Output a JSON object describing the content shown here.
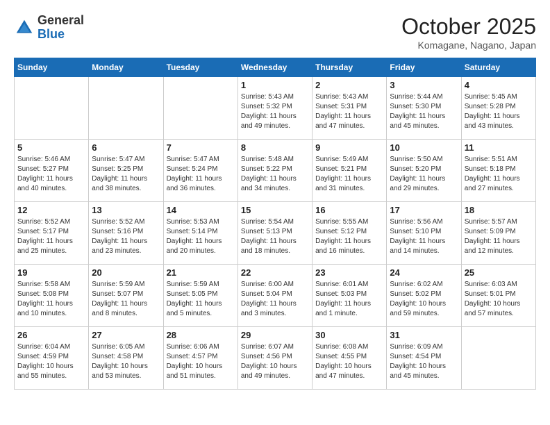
{
  "header": {
    "logo": {
      "general": "General",
      "blue": "Blue"
    },
    "month": "October 2025",
    "location": "Komagane, Nagano, Japan"
  },
  "weekdays": [
    "Sunday",
    "Monday",
    "Tuesday",
    "Wednesday",
    "Thursday",
    "Friday",
    "Saturday"
  ],
  "weeks": [
    [
      {
        "day": "",
        "info": ""
      },
      {
        "day": "",
        "info": ""
      },
      {
        "day": "",
        "info": ""
      },
      {
        "day": "1",
        "info": "Sunrise: 5:43 AM\nSunset: 5:32 PM\nDaylight: 11 hours\nand 49 minutes."
      },
      {
        "day": "2",
        "info": "Sunrise: 5:43 AM\nSunset: 5:31 PM\nDaylight: 11 hours\nand 47 minutes."
      },
      {
        "day": "3",
        "info": "Sunrise: 5:44 AM\nSunset: 5:30 PM\nDaylight: 11 hours\nand 45 minutes."
      },
      {
        "day": "4",
        "info": "Sunrise: 5:45 AM\nSunset: 5:28 PM\nDaylight: 11 hours\nand 43 minutes."
      }
    ],
    [
      {
        "day": "5",
        "info": "Sunrise: 5:46 AM\nSunset: 5:27 PM\nDaylight: 11 hours\nand 40 minutes."
      },
      {
        "day": "6",
        "info": "Sunrise: 5:47 AM\nSunset: 5:25 PM\nDaylight: 11 hours\nand 38 minutes."
      },
      {
        "day": "7",
        "info": "Sunrise: 5:47 AM\nSunset: 5:24 PM\nDaylight: 11 hours\nand 36 minutes."
      },
      {
        "day": "8",
        "info": "Sunrise: 5:48 AM\nSunset: 5:22 PM\nDaylight: 11 hours\nand 34 minutes."
      },
      {
        "day": "9",
        "info": "Sunrise: 5:49 AM\nSunset: 5:21 PM\nDaylight: 11 hours\nand 31 minutes."
      },
      {
        "day": "10",
        "info": "Sunrise: 5:50 AM\nSunset: 5:20 PM\nDaylight: 11 hours\nand 29 minutes."
      },
      {
        "day": "11",
        "info": "Sunrise: 5:51 AM\nSunset: 5:18 PM\nDaylight: 11 hours\nand 27 minutes."
      }
    ],
    [
      {
        "day": "12",
        "info": "Sunrise: 5:52 AM\nSunset: 5:17 PM\nDaylight: 11 hours\nand 25 minutes."
      },
      {
        "day": "13",
        "info": "Sunrise: 5:52 AM\nSunset: 5:16 PM\nDaylight: 11 hours\nand 23 minutes."
      },
      {
        "day": "14",
        "info": "Sunrise: 5:53 AM\nSunset: 5:14 PM\nDaylight: 11 hours\nand 20 minutes."
      },
      {
        "day": "15",
        "info": "Sunrise: 5:54 AM\nSunset: 5:13 PM\nDaylight: 11 hours\nand 18 minutes."
      },
      {
        "day": "16",
        "info": "Sunrise: 5:55 AM\nSunset: 5:12 PM\nDaylight: 11 hours\nand 16 minutes."
      },
      {
        "day": "17",
        "info": "Sunrise: 5:56 AM\nSunset: 5:10 PM\nDaylight: 11 hours\nand 14 minutes."
      },
      {
        "day": "18",
        "info": "Sunrise: 5:57 AM\nSunset: 5:09 PM\nDaylight: 11 hours\nand 12 minutes."
      }
    ],
    [
      {
        "day": "19",
        "info": "Sunrise: 5:58 AM\nSunset: 5:08 PM\nDaylight: 11 hours\nand 10 minutes."
      },
      {
        "day": "20",
        "info": "Sunrise: 5:59 AM\nSunset: 5:07 PM\nDaylight: 11 hours\nand 8 minutes."
      },
      {
        "day": "21",
        "info": "Sunrise: 5:59 AM\nSunset: 5:05 PM\nDaylight: 11 hours\nand 5 minutes."
      },
      {
        "day": "22",
        "info": "Sunrise: 6:00 AM\nSunset: 5:04 PM\nDaylight: 11 hours\nand 3 minutes."
      },
      {
        "day": "23",
        "info": "Sunrise: 6:01 AM\nSunset: 5:03 PM\nDaylight: 11 hours\nand 1 minute."
      },
      {
        "day": "24",
        "info": "Sunrise: 6:02 AM\nSunset: 5:02 PM\nDaylight: 10 hours\nand 59 minutes."
      },
      {
        "day": "25",
        "info": "Sunrise: 6:03 AM\nSunset: 5:01 PM\nDaylight: 10 hours\nand 57 minutes."
      }
    ],
    [
      {
        "day": "26",
        "info": "Sunrise: 6:04 AM\nSunset: 4:59 PM\nDaylight: 10 hours\nand 55 minutes."
      },
      {
        "day": "27",
        "info": "Sunrise: 6:05 AM\nSunset: 4:58 PM\nDaylight: 10 hours\nand 53 minutes."
      },
      {
        "day": "28",
        "info": "Sunrise: 6:06 AM\nSunset: 4:57 PM\nDaylight: 10 hours\nand 51 minutes."
      },
      {
        "day": "29",
        "info": "Sunrise: 6:07 AM\nSunset: 4:56 PM\nDaylight: 10 hours\nand 49 minutes."
      },
      {
        "day": "30",
        "info": "Sunrise: 6:08 AM\nSunset: 4:55 PM\nDaylight: 10 hours\nand 47 minutes."
      },
      {
        "day": "31",
        "info": "Sunrise: 6:09 AM\nSunset: 4:54 PM\nDaylight: 10 hours\nand 45 minutes."
      },
      {
        "day": "",
        "info": ""
      }
    ]
  ]
}
